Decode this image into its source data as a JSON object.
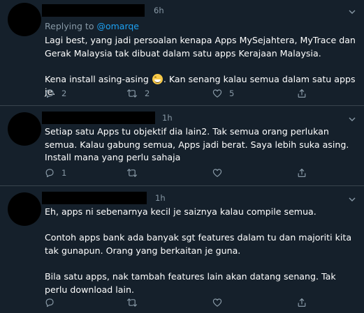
{
  "colors": {
    "background": "#15202b",
    "text": "#ffffff",
    "muted": "#8899a6",
    "link": "#1da1f2",
    "divider": "#38444d"
  },
  "tweets": [
    {
      "time": "6h",
      "reply_prefix": "Replying to",
      "reply_handle": "@omarqe",
      "paragraphs": [
        "Lagi best, yang jadi persoalan kenapa Apps MySejahtera, MyTrace dan Gerak Malaysia tak dibuat dalam satu apps Kerajaan Malaysia.",
        "Kena install asing-asing",
        ". Kan senang kalau semua dalam satu apps je."
      ],
      "emoji": "grinning-sweat-emoji",
      "replies": "2",
      "retweets": "2",
      "likes": "5"
    },
    {
      "time": "1h",
      "paragraphs": [
        "Setiap satu Apps tu objektif dia lain2. Tak semua orang perlukan semua. Kalau gabung semua, Apps jadi berat. Saya lebih suka asing. Install mana yang perlu sahaja"
      ],
      "replies": "1",
      "retweets": "",
      "likes": ""
    },
    {
      "time": "1h",
      "paragraphs": [
        "Eh, apps ni sebenarnya kecil je saiznya kalau compile semua.",
        "Contoh apps bank ada banyak sgt features dalam tu dan majoriti kita tak gunapun. Orang yang berkaitan je guna.",
        "Bila satu apps, nak tambah features lain akan datang senang. Tak perlu download lain."
      ],
      "replies": "",
      "retweets": "",
      "likes": ""
    }
  ]
}
